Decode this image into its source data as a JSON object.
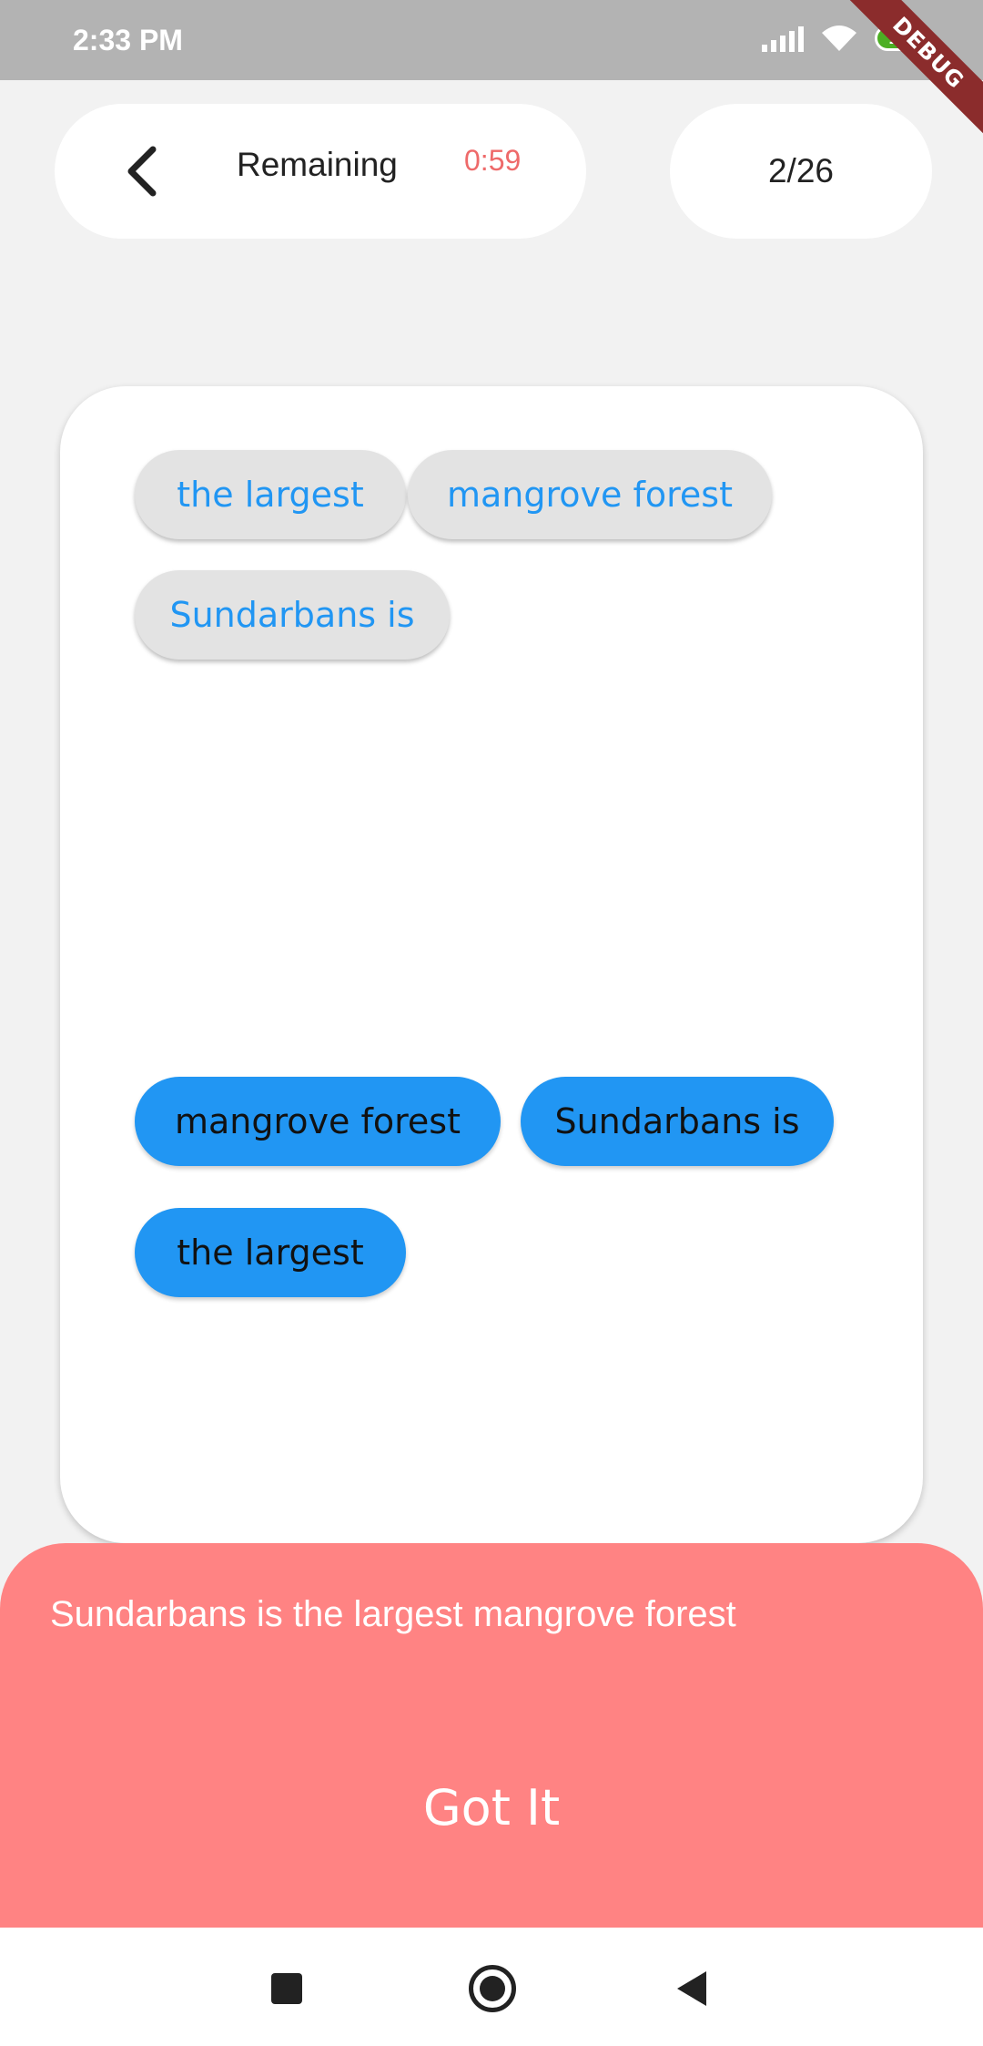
{
  "status_bar": {
    "time": "2:33 PM",
    "battery_level": "100",
    "icons": [
      "signal-icon",
      "wifi-icon",
      "battery-icon"
    ]
  },
  "debug_banner": "DEBUG",
  "header": {
    "back_icon": "chevron-left-icon",
    "remaining_label": "Remaining",
    "remaining_time": "0:59",
    "progress": "2/26"
  },
  "card": {
    "options": [
      {
        "label": "the largest"
      },
      {
        "label": "mangrove forest"
      },
      {
        "label": "Sundarbans is"
      }
    ],
    "answer_chips": [
      {
        "label": "mangrove forest"
      },
      {
        "label": "Sundarbans is"
      },
      {
        "label": "the largest"
      }
    ]
  },
  "answer_panel": {
    "correct_sentence": "Sundarbans is the largest mangrove forest",
    "button_label": "Got It"
  },
  "colors": {
    "accent_blue": "#2196f3",
    "answer_panel": "#ff8383",
    "timer_red": "#ee6a6a"
  },
  "nav_bar": {
    "icons": [
      "recents-icon",
      "home-icon",
      "back-icon"
    ]
  }
}
